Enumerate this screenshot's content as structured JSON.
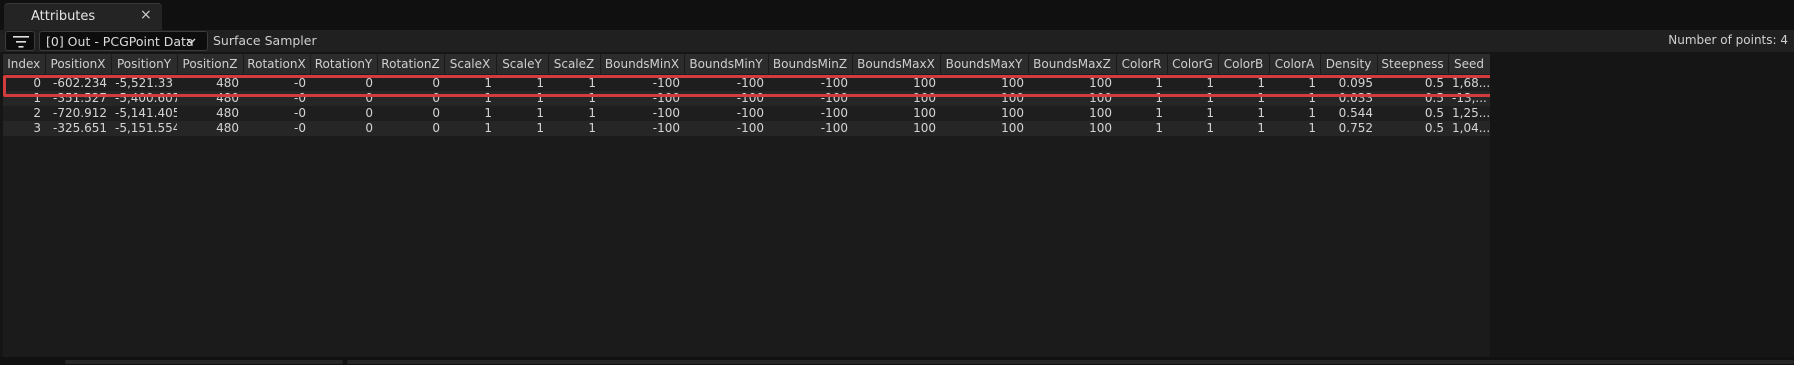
{
  "tab": {
    "title": "Attributes",
    "close_glyph": "×"
  },
  "toolbar": {
    "filter_icon": "filter-lines-icon",
    "data_select_value": "[0] Out - PCGPoint Data",
    "node_label": "Surface Sampler",
    "point_count_label": "Number of points: 4"
  },
  "table": {
    "columns": [
      "Index",
      "PositionX",
      "PositionY",
      "PositionZ",
      "RotationX",
      "RotationY",
      "RotationZ",
      "ScaleX",
      "ScaleY",
      "ScaleZ",
      "BoundsMinX",
      "BoundsMinY",
      "BoundsMinZ",
      "BoundsMaxX",
      "BoundsMaxY",
      "BoundsMaxZ",
      "ColorR",
      "ColorG",
      "ColorB",
      "ColorA",
      "Density",
      "Steepness",
      "Seed"
    ],
    "rows": [
      [
        "0",
        "-602.234",
        "-5,521.33",
        "480",
        "-0",
        "0",
        "0",
        "1",
        "1",
        "1",
        "-100",
        "-100",
        "-100",
        "100",
        "100",
        "100",
        "1",
        "1",
        "1",
        "1",
        "0.095",
        "0.5",
        "1,68..."
      ],
      [
        "1",
        "-351.527",
        "-5,400.607",
        "480",
        "-0",
        "0",
        "0",
        "1",
        "1",
        "1",
        "-100",
        "-100",
        "-100",
        "100",
        "100",
        "100",
        "1",
        "1",
        "1",
        "1",
        "0.033",
        "0.5",
        "-13,..."
      ],
      [
        "2",
        "-720.912",
        "-5,141.405",
        "480",
        "-0",
        "0",
        "0",
        "1",
        "1",
        "1",
        "-100",
        "-100",
        "-100",
        "100",
        "100",
        "100",
        "1",
        "1",
        "1",
        "1",
        "0.544",
        "0.5",
        "1,25..."
      ],
      [
        "3",
        "-325.651",
        "-5,151.554",
        "480",
        "-0",
        "0",
        "0",
        "1",
        "1",
        "1",
        "-100",
        "-100",
        "-100",
        "100",
        "100",
        "100",
        "1",
        "1",
        "1",
        "1",
        "0.752",
        "0.5",
        "1,04..."
      ]
    ],
    "selected_row_index": 0
  },
  "colors": {
    "highlight": "#d23c3c"
  }
}
